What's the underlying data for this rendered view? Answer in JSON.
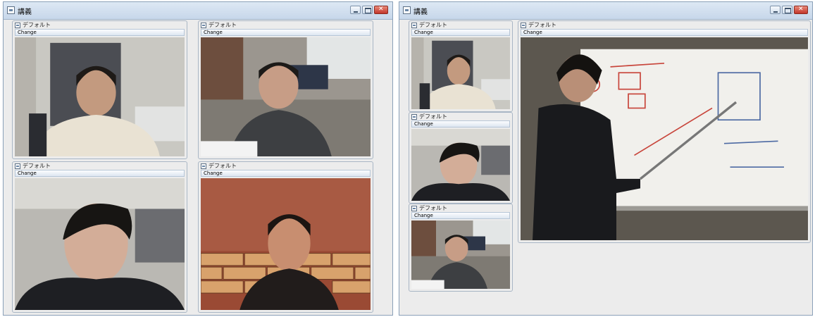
{
  "windows": [
    {
      "title": "講義",
      "panels": [
        {
          "title": "デフォルト",
          "button": "Change",
          "feed": "man-white-sweater"
        },
        {
          "title": "デフォルト",
          "button": "Change",
          "feed": "man-glasses-office"
        },
        {
          "title": "デフォルト",
          "button": "Change",
          "feed": "man-black-jacket-closeup"
        },
        {
          "title": "デフォルト",
          "button": "Change",
          "feed": "man-brick-wall"
        }
      ]
    },
    {
      "title": "講義",
      "panels": [
        {
          "title": "デフォルト",
          "button": "Change",
          "feed": "man-white-sweater"
        },
        {
          "title": "デフォルト",
          "button": "Change",
          "feed": "man-black-jacket"
        },
        {
          "title": "デフォルト",
          "button": "Change",
          "feed": "man-glasses-office"
        },
        {
          "title": "デフォルト",
          "button": "Change",
          "feed": "presenter-whiteboard"
        }
      ]
    }
  ],
  "colors": {
    "titlebar": "#c7d7ea",
    "panel_border": "#a9b6c5",
    "close_button": "#c2362a"
  }
}
